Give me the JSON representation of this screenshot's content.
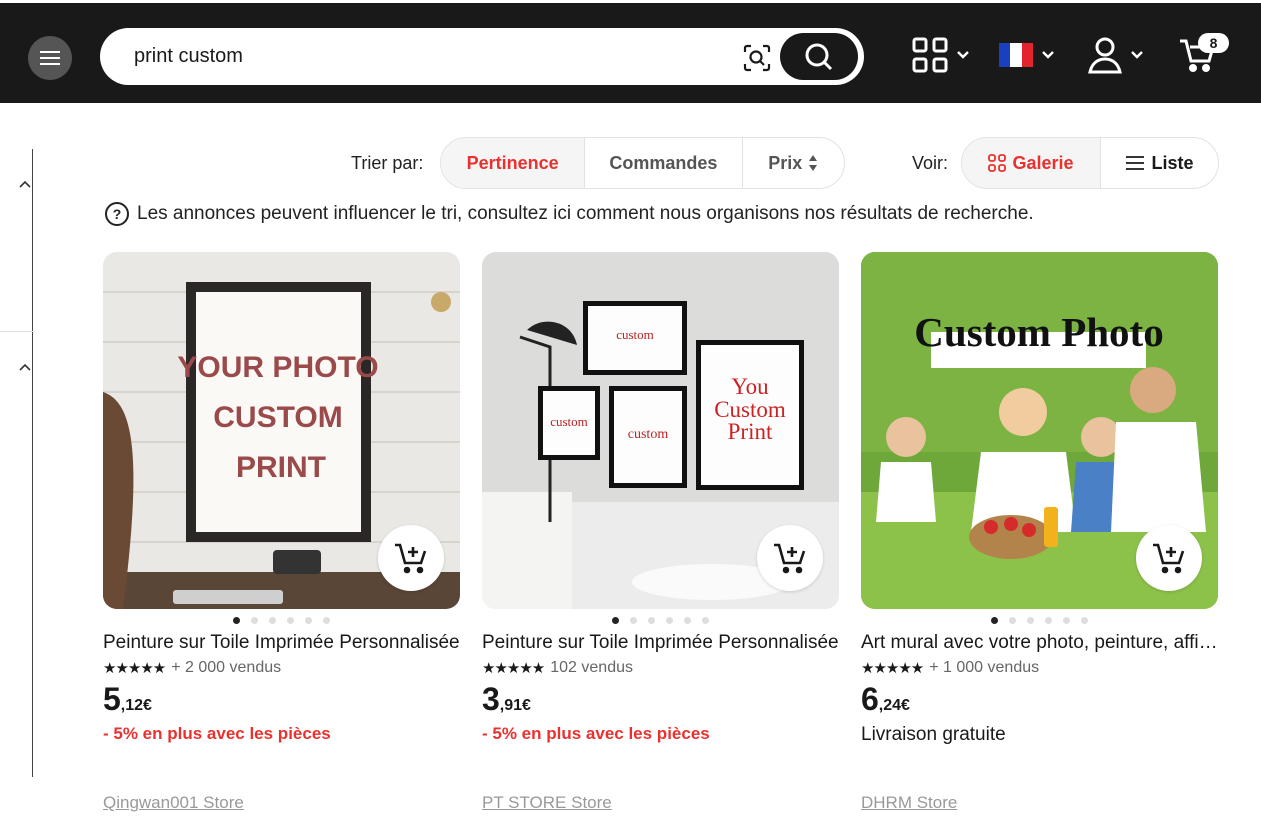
{
  "header": {
    "search_value": "print custom",
    "cart_count": "8"
  },
  "sort": {
    "label": "Trier par:",
    "options": [
      "Pertinence",
      "Commandes",
      "Prix"
    ],
    "active": "Pertinence"
  },
  "view": {
    "label": "Voir:",
    "options": [
      "Galerie",
      "Liste"
    ],
    "active": "Galerie"
  },
  "notice": "Les annonces peuvent influencer le tri, consultez ici comment nous organisons nos résultats de recherche.",
  "products": [
    {
      "image_text": [
        "YOUR PHOTO",
        "CUSTOM",
        "PRINT"
      ],
      "title": "Peinture sur Toile Imprimée Personnalisée",
      "rating": "★★★★★",
      "sold": "+ 2 000 vendus",
      "price_int": "5",
      "price_dec": ",12€",
      "promo": "- 5% en plus avec les pièces",
      "shipping": "",
      "store": "Qingwan001 Store"
    },
    {
      "image_text": [
        "custom",
        "custom",
        "custom",
        "You",
        "Custom",
        "Print"
      ],
      "title": "Peinture sur Toile Imprimée Personnalisée",
      "rating": "★★★★★",
      "sold": "102 vendus",
      "price_int": "3",
      "price_dec": ",91€",
      "promo": "- 5% en plus avec les pièces",
      "shipping": "",
      "store": "PT STORE Store"
    },
    {
      "image_text": [
        "Custom Photo"
      ],
      "title": "Art mural avec votre photo, peinture, affiche",
      "rating": "★★★★★",
      "sold": "+ 1 000 vendus",
      "price_int": "6",
      "price_dec": ",24€",
      "promo": "",
      "shipping": "Livraison gratuite",
      "store": "DHRM Store"
    }
  ],
  "colors": {
    "header_bg": "#191919",
    "accent_red": "#e8322f"
  }
}
